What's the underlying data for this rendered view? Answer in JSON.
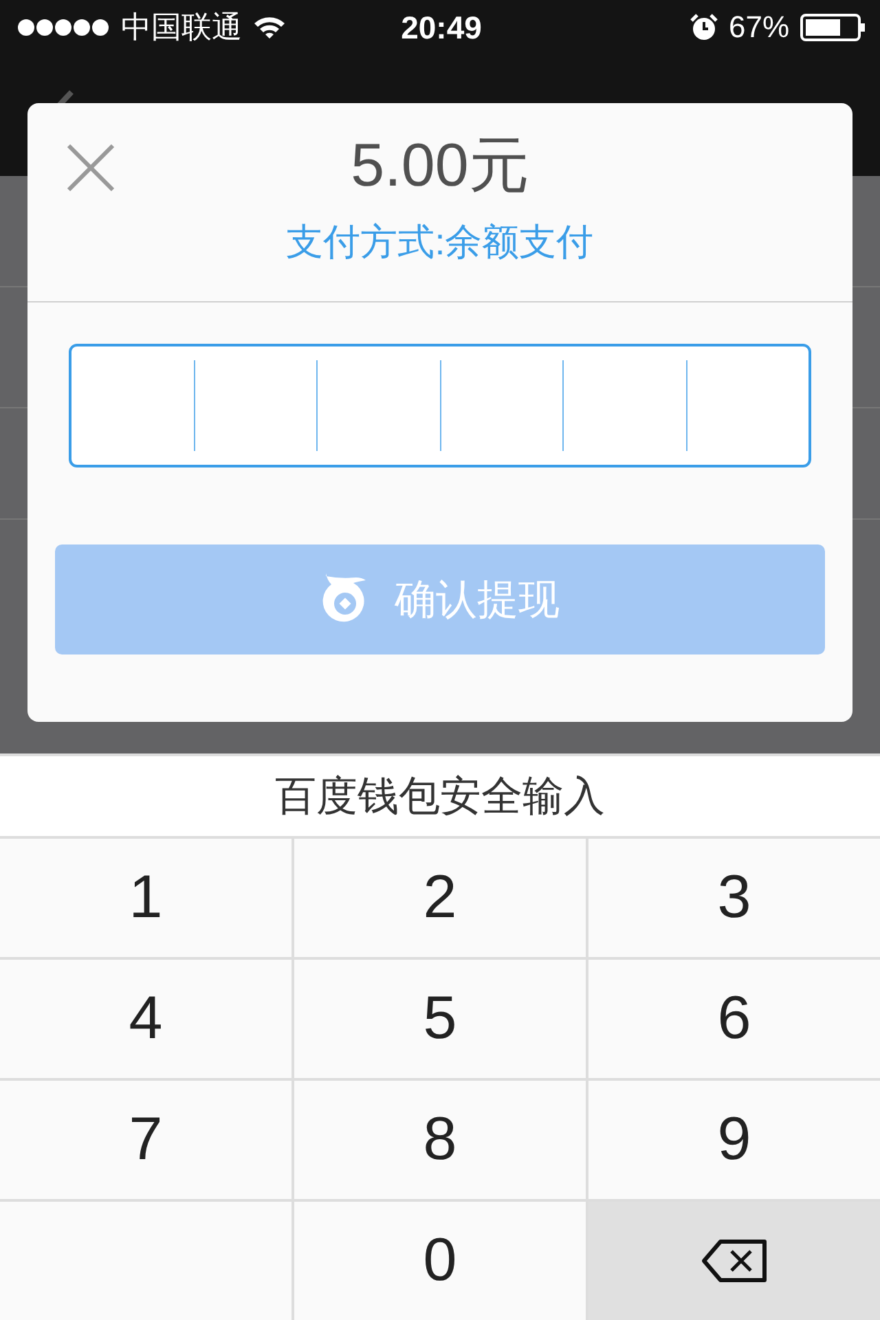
{
  "status_bar": {
    "carrier": "中国联通",
    "time": "20:49",
    "battery": "67%"
  },
  "dialog": {
    "amount": "5.00元",
    "payment_method": "支付方式:余额支付",
    "confirm_button": {
      "label": "确认提现",
      "disabled": true
    }
  },
  "keyboard": {
    "title": "百度钱包安全输入",
    "keys": [
      {
        "kind": "digit",
        "label": "1"
      },
      {
        "kind": "digit",
        "label": "2"
      },
      {
        "kind": "digit",
        "label": "3"
      },
      {
        "kind": "digit",
        "label": "4"
      },
      {
        "kind": "digit",
        "label": "5"
      },
      {
        "kind": "digit",
        "label": "6"
      },
      {
        "kind": "digit",
        "label": "7"
      },
      {
        "kind": "digit",
        "label": "8"
      },
      {
        "kind": "digit",
        "label": "9"
      },
      {
        "kind": "blank"
      },
      {
        "kind": "digit",
        "label": "0"
      },
      {
        "kind": "delete"
      }
    ]
  }
}
